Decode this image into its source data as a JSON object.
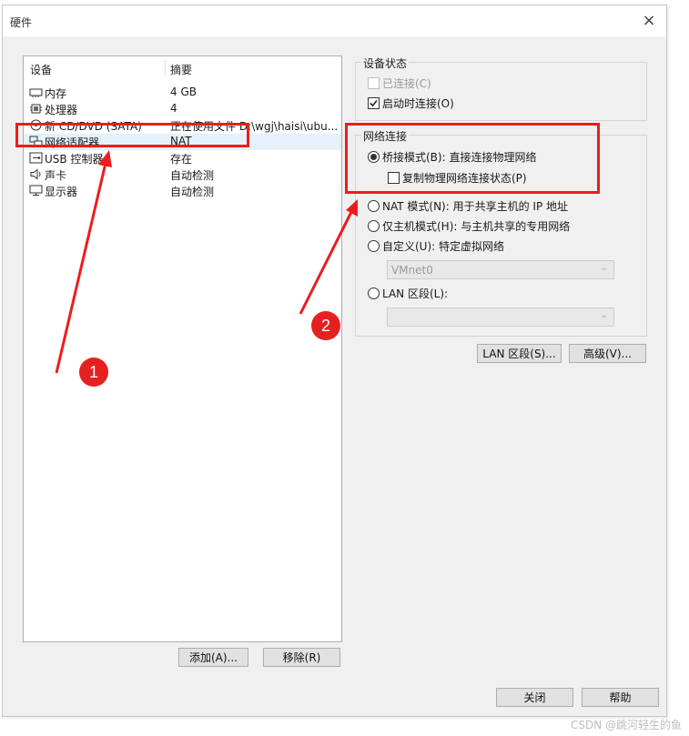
{
  "window": {
    "title": "硬件",
    "close_glyph": "×"
  },
  "device_list": {
    "header_device": "设备",
    "header_summary": "摘要",
    "items": [
      {
        "name": "内存",
        "summary": "4 GB",
        "icon": "memory-icon"
      },
      {
        "name": "处理器",
        "summary": "4",
        "icon": "processor-icon"
      },
      {
        "name": "新 CD/DVD (SATA)",
        "summary": "正在使用文件 D:\\wgj\\haisi\\ubu...",
        "icon": "cd-dvd-icon"
      },
      {
        "name": "网络适配器",
        "summary": "NAT",
        "icon": "network-adapter-icon",
        "selected": true
      },
      {
        "name": "USB 控制器",
        "summary": "存在",
        "icon": "usb-icon"
      },
      {
        "name": "声卡",
        "summary": "自动检测",
        "icon": "sound-card-icon"
      },
      {
        "name": "显示器",
        "summary": "自动检测",
        "icon": "monitor-icon"
      }
    ],
    "add_button": "添加(A)...",
    "remove_button": "移除(R)"
  },
  "device_status": {
    "label": "设备状态",
    "connected": {
      "label": "已连接(C)",
      "checked": false,
      "disabled": true
    },
    "connect_on_start": {
      "label": "启动时连接(O)",
      "checked": true
    }
  },
  "network_connection": {
    "label": "网络连接",
    "bridged": {
      "label": "桥接模式(B): 直接连接物理网络",
      "selected": true
    },
    "replicate": {
      "label": "复制物理网络连接状态(P)",
      "checked": false
    },
    "nat": {
      "label": "NAT 模式(N): 用于共享主机的 IP 地址",
      "selected": false
    },
    "host_only": {
      "label": "仅主机模式(H): 与主机共享的专用网络",
      "selected": false
    },
    "custom": {
      "label": "自定义(U): 特定虚拟网络",
      "selected": false
    },
    "custom_value": "VMnet0",
    "lan_segment": {
      "label": "LAN 区段(L):",
      "selected": false
    },
    "lan_segment_value": ""
  },
  "actions": {
    "lan_segments_button": "LAN 区段(S)...",
    "advanced_button": "高级(V)...",
    "close_button": "关闭",
    "help_button": "帮助"
  },
  "annotations": {
    "badge_1": "1",
    "badge_2": "2",
    "color": "#ee1c1c"
  },
  "watermark": "CSDN @跳河轻生的鱼"
}
